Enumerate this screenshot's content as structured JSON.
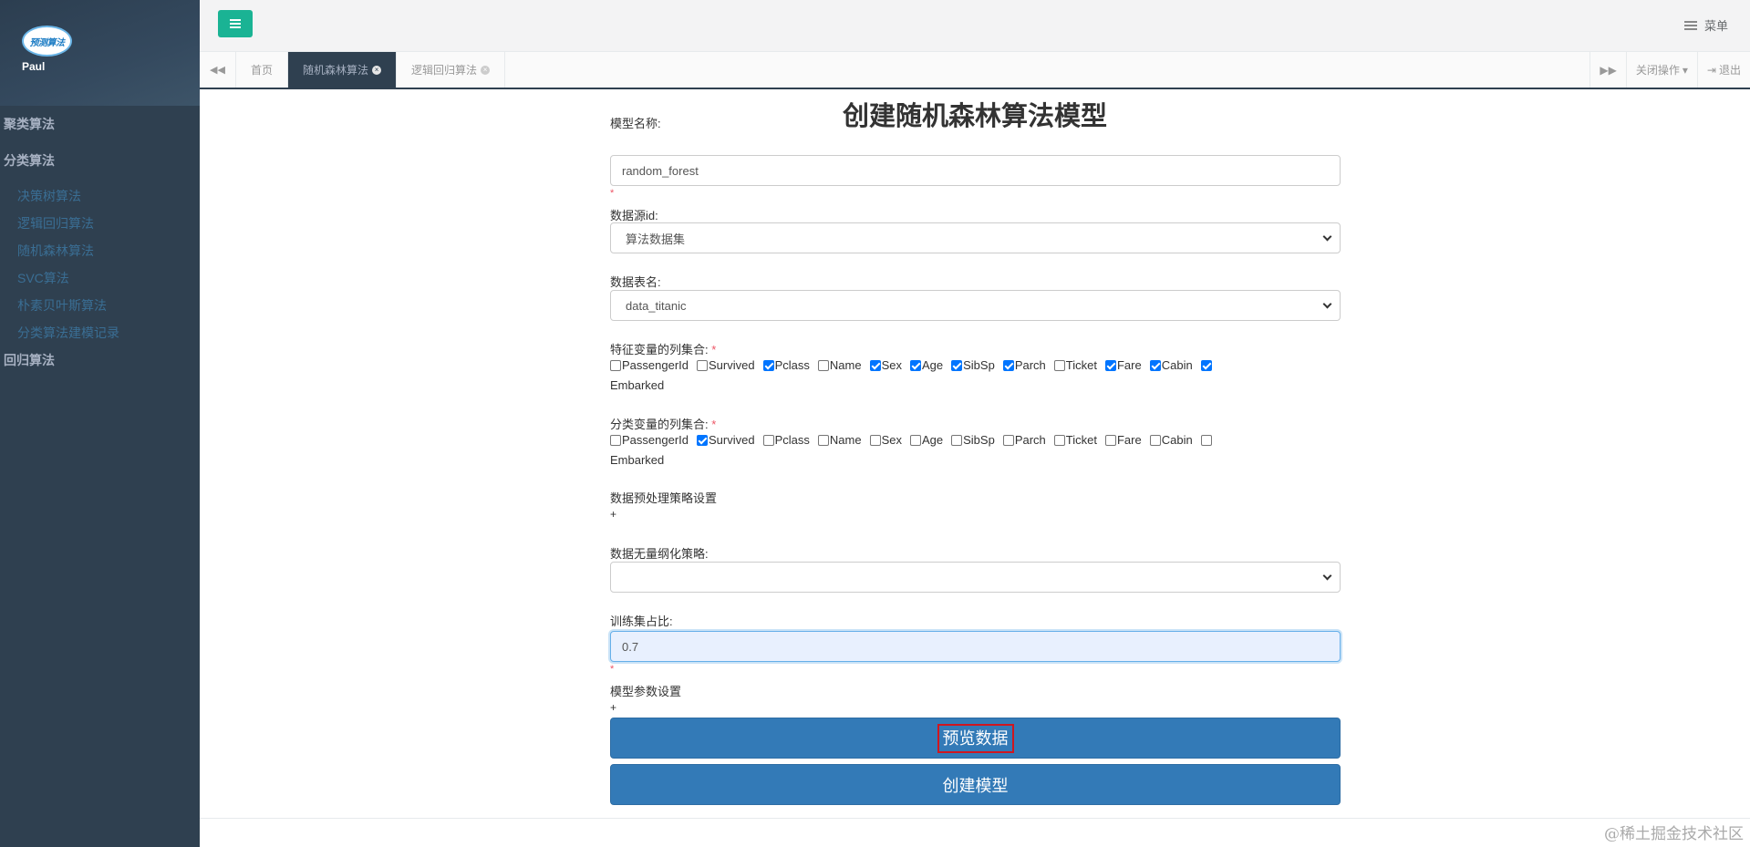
{
  "sidebar": {
    "logo_text": "预测算法",
    "user_name": "Paul",
    "groups": [
      {
        "label": "聚类算法"
      },
      {
        "label": "分类算法"
      }
    ],
    "sub_items": [
      {
        "label": "决策树算法"
      },
      {
        "label": "逻辑回归算法"
      },
      {
        "label": "随机森林算法"
      },
      {
        "label": "SVC算法"
      },
      {
        "label": "朴素贝叶斯算法"
      },
      {
        "label": "分类算法建模记录"
      }
    ],
    "last_group": {
      "label": "回归算法"
    }
  },
  "topbar": {
    "menu_label": "菜单"
  },
  "tabs": {
    "items": [
      {
        "label": "首页"
      },
      {
        "label": "随机森林算法"
      },
      {
        "label": "逻辑回归算法"
      }
    ],
    "close_ops": "关闭操作",
    "logout": "退出"
  },
  "form": {
    "title": "创建随机森林算法模型",
    "model_name_label": "模型名称:",
    "model_name_value": "random_forest",
    "datasource_label": "数据源id:",
    "datasource_value": "算法数据集",
    "table_label": "数据表名:",
    "table_value": "data_titanic",
    "feature_label": "特征变量的列集合:",
    "target_label": "分类变量的列集合:",
    "columns": [
      "PassengerId",
      "Survived",
      "Pclass",
      "Name",
      "Sex",
      "Age",
      "SibSp",
      "Parch",
      "Ticket",
      "Fare",
      "Cabin",
      "Embarked"
    ],
    "feature_checked": [
      false,
      false,
      true,
      false,
      true,
      true,
      true,
      true,
      false,
      true,
      true,
      true
    ],
    "target_checked": [
      false,
      true,
      false,
      false,
      false,
      false,
      false,
      false,
      false,
      false,
      false,
      false
    ],
    "preprocess_label": "数据预处理策略设置",
    "plus": "+",
    "dimless_label": "数据无量纲化策略:",
    "dimless_value": "",
    "train_ratio_label": "训练集占比:",
    "train_ratio_value": "0.7",
    "params_label": "模型参数设置",
    "star": "*",
    "preview_button": "预览数据",
    "create_button": "创建模型"
  },
  "watermark": "@稀土掘金技术社区"
}
